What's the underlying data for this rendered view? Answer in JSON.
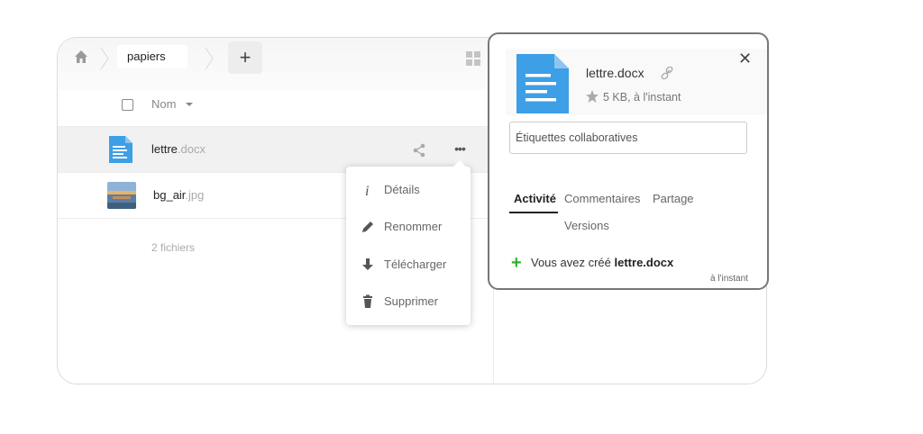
{
  "breadcrumb": {
    "folder": "papiers"
  },
  "toolbar": {
    "add_label": "+"
  },
  "table": {
    "column_name": "Nom",
    "files": [
      {
        "base": "lettre",
        "ext": ".docx"
      },
      {
        "base": "bg_air",
        "ext": ".jpg"
      }
    ],
    "summary": "2 fichiers"
  },
  "context_menu": {
    "items": [
      {
        "label": "Détails",
        "icon": "info-icon"
      },
      {
        "label": "Renommer",
        "icon": "pencil-icon"
      },
      {
        "label": "Télécharger",
        "icon": "download-icon"
      },
      {
        "label": "Supprimer",
        "icon": "trash-icon"
      }
    ]
  },
  "details": {
    "filename": "lettre.docx",
    "meta": "5 KB, à l'instant",
    "tags_placeholder": "Étiquettes collaboratives",
    "tabs": [
      "Activité",
      "Commentaires",
      "Partage",
      "Versions"
    ],
    "activity": {
      "prefix": "Vous avez créé",
      "file": "lettre.docx",
      "time": "à l'instant"
    }
  },
  "colors": {
    "doc_blue": "#3d9fe6",
    "activity_green": "#2bb32b",
    "panel_border": "#777777"
  }
}
